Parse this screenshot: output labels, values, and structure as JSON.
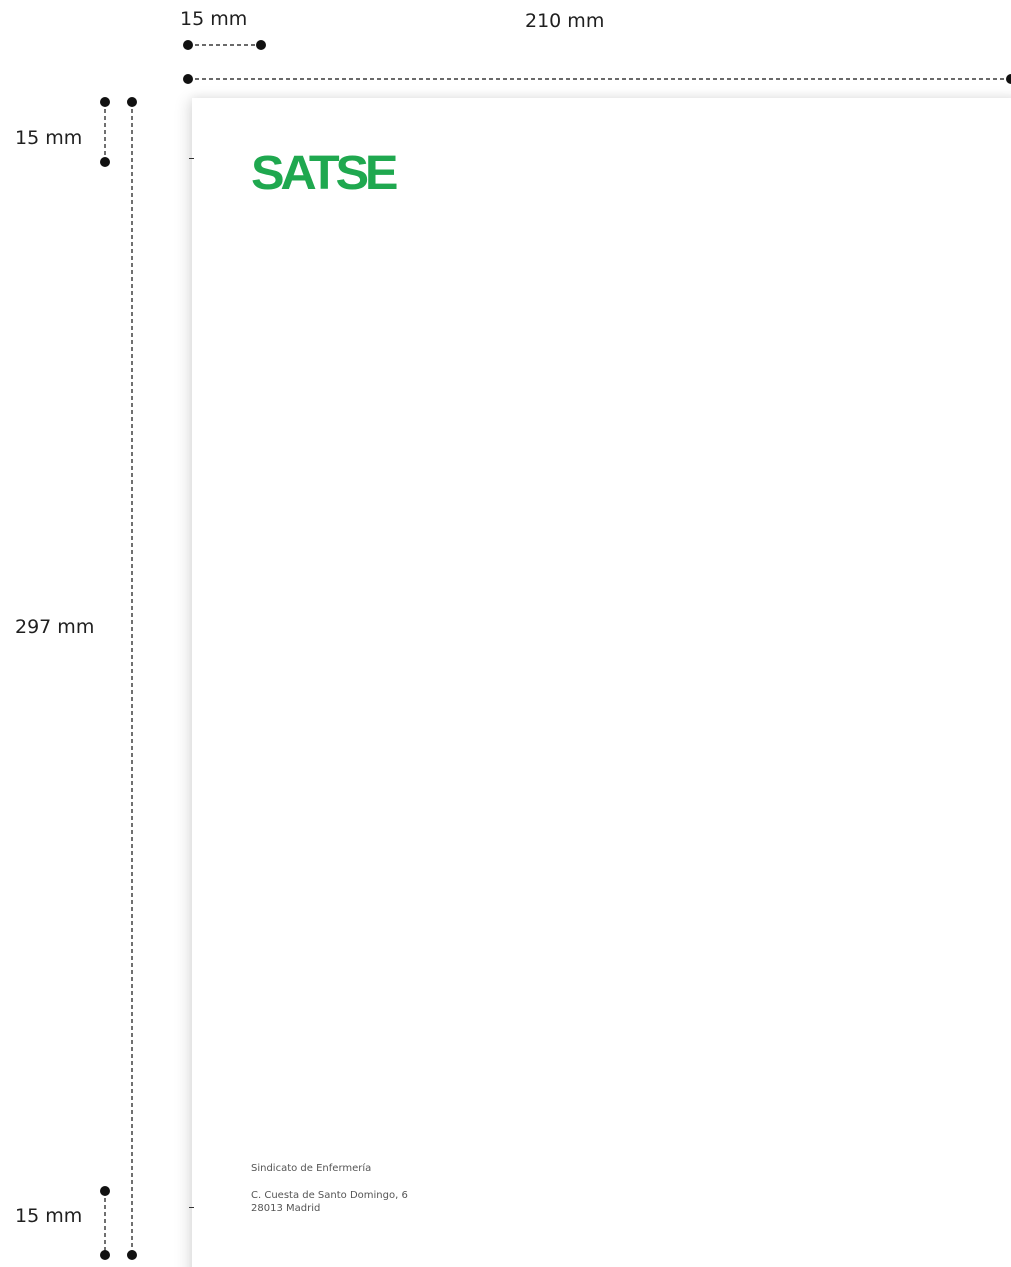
{
  "dimensions": {
    "top_margin_horizontal_label": "15 mm",
    "page_width_label": "210 mm",
    "top_margin_vertical_label": "15 mm",
    "page_height_label": "297 mm",
    "bottom_margin_label": "15 mm"
  },
  "letterhead": {
    "logo_text": "SATSE",
    "brand_color": "#1fa84f",
    "organization": "Sindicato de Enfermería",
    "address_line1": "C. Cuesta de Santo Domingo, 6",
    "address_line2": "28013 Madrid"
  },
  "guide_color": "#111111"
}
